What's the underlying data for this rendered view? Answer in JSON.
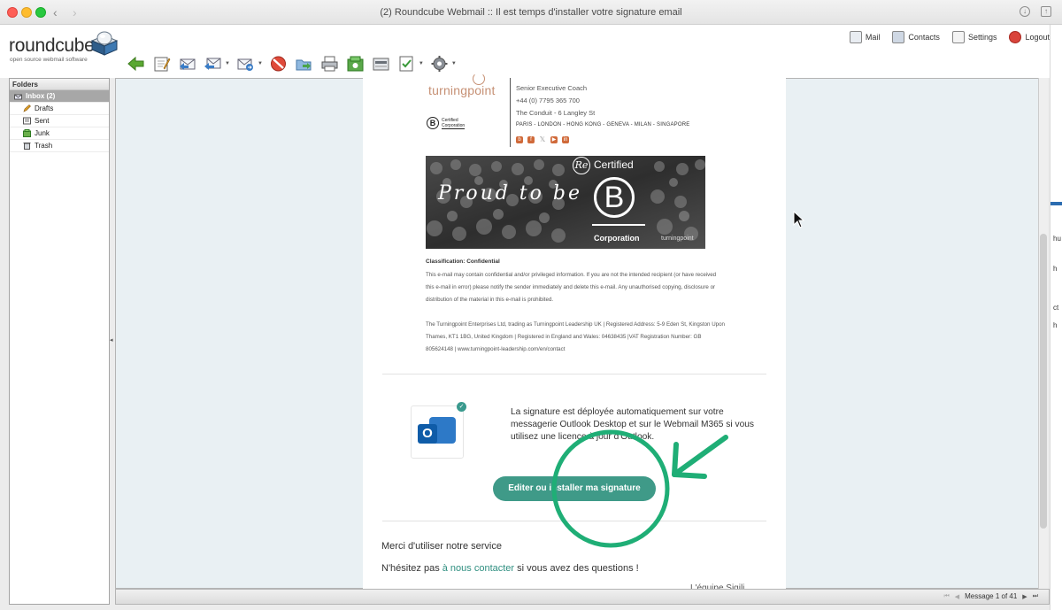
{
  "window": {
    "title": "(2) Roundcube Webmail :: Il est temps d'installer votre signature email",
    "back": "‹",
    "forward": "›"
  },
  "app": {
    "logo": "roundcube",
    "tagline": "open source webmail software"
  },
  "topnav": [
    {
      "label": "Mail",
      "icon": "mail-icon"
    },
    {
      "label": "Contacts",
      "icon": "contacts-icon"
    },
    {
      "label": "Settings",
      "icon": "settings-icon"
    },
    {
      "label": "Logout",
      "icon": "logout-icon"
    }
  ],
  "toolbar": {
    "icons": [
      "back-arrow-icon",
      "compose-icon",
      "reply-icon",
      "reply-all-icon",
      "forward-icon",
      "delete-icon",
      "move-icon",
      "print-icon",
      "mark-icon",
      "archive-icon",
      "view-source-icon",
      "more-gear-icon"
    ]
  },
  "folders": {
    "title": "Folders",
    "items": [
      {
        "label": "Inbox (2)",
        "icon": "inbox-icon"
      },
      {
        "label": "Drafts",
        "icon": "drafts-icon"
      },
      {
        "label": "Sent",
        "icon": "sent-icon"
      },
      {
        "label": "Junk",
        "icon": "junk-icon"
      },
      {
        "label": "Trash",
        "icon": "trash-icon"
      }
    ]
  },
  "signature": {
    "brand": "turningpoint",
    "role": "Senior Executive Coach",
    "phone": "+44 (0) 7795 365 700",
    "address": "The Conduit - 6 Langley St",
    "cities": "PARIS - LONDON - HONG KONG - GENEVA - MILAN - SINGAPORE",
    "bcorp_line1": "Certified",
    "bcorp_line2": "Corporation",
    "banner_text": "Proud to be",
    "banner_cert": "Certified",
    "banner_re": "Re",
    "banner_b": "B",
    "banner_corp": "Corporation",
    "banner_tp": "turningpoint",
    "socials": [
      "b",
      "f",
      "𝕏",
      "▶",
      "in"
    ]
  },
  "email": {
    "classification": "Classification: Confidential",
    "confidential": "This e-mail may contain confidential and/or privileged information. If you are not the intended recipient (or have received this e-mail in error) please notify the sender immediately and delete this e-mail. Any unauthorised copying, disclosure or distribution of the material in this e-mail is prohibited.",
    "legal": "The Turningpoint Enterprises Ltd, trading as Turningpoint Leadership UK | Registered Address: 5-9 Eden St, Kingston Upon Thames, KT1 1BG, United Kingdom | Registered in England and Wales: 04638435 |VAT Registration Number: GB 805624148 | www.turningpoint-leadership.com/en/contact",
    "deploy_text": "La signature est déployée automatiquement sur votre messagerie Outlook Desktop et sur le Webmail M365 si vous utilisez une licence à jour d'Outlook.",
    "outlook_letter": "O",
    "check": "✓",
    "cta": "Editer ou installer ma signature",
    "thanks": "Merci d'utiliser notre service",
    "contact_before": "N'hésitez pas ",
    "contact_link": "à nous contacter",
    "contact_after": " si vous avez des questions !",
    "cutoff": "L'équipe Sigili..."
  },
  "status": {
    "message": "Message 1 of 41",
    "first": "⏮",
    "prev": "◀",
    "next": "▶",
    "last": "⏭"
  },
  "side_fragments": [
    "hu",
    "h",
    "ct",
    "h"
  ],
  "colors": {
    "accent": "#3f9a88",
    "brand": "#c69074",
    "annotation": "#1fae76"
  }
}
